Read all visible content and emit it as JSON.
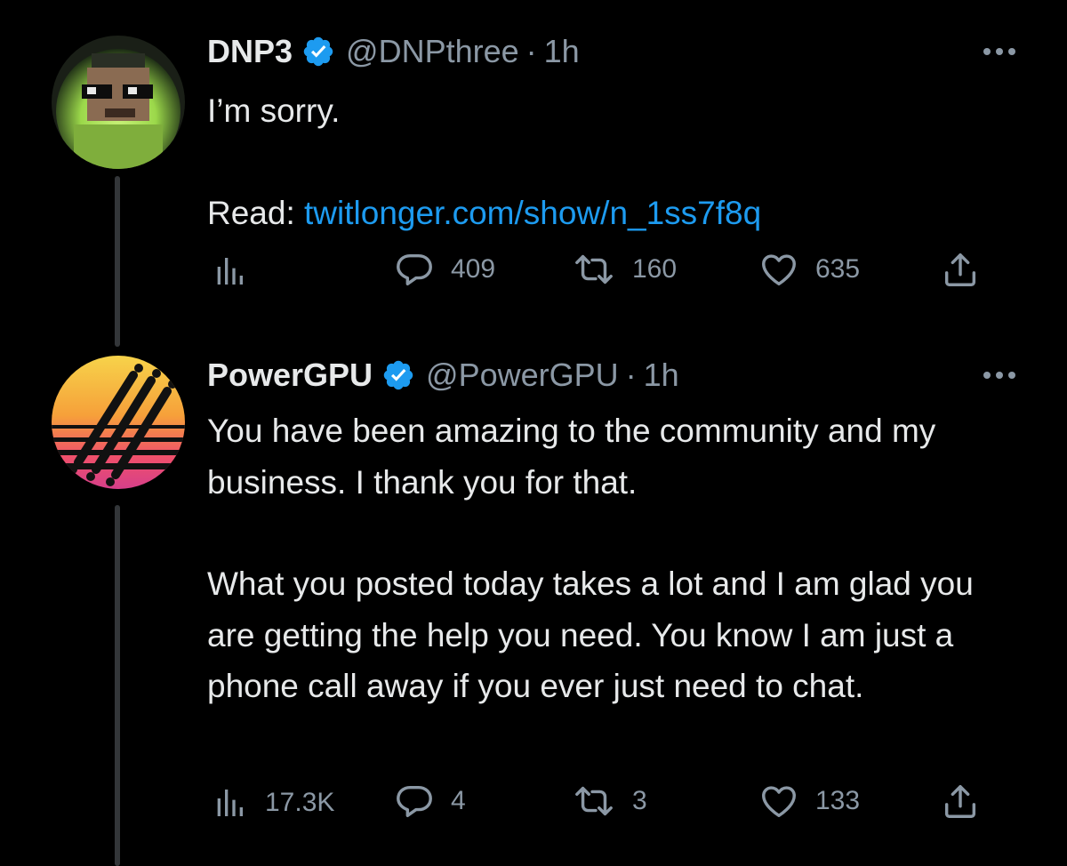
{
  "tweets": [
    {
      "name": "DNP3",
      "handle": "@DNPthree",
      "separator": "·",
      "time": "1h",
      "body": [
        "I’m sorry.",
        ""
      ],
      "read_prefix": "Read: ",
      "link": "twitlonger.com/show/n_1ss7f8q",
      "views": "",
      "replies": "409",
      "retweets": "160",
      "likes": "635"
    },
    {
      "name": "PowerGPU",
      "handle": "@PowerGPU",
      "separator": "·",
      "time": "1h",
      "body": [
        "You have been amazing to the community and my business. I thank you for that.",
        "What you posted today takes a lot and I am glad you are getting the help you need. You know I am just a phone call away if you ever just need to chat."
      ],
      "views": "17.3K",
      "replies": "4",
      "retweets": "3",
      "likes": "133"
    }
  ],
  "colors": {
    "background": "#000000",
    "text": "#e7e9ea",
    "muted": "#8b98a5",
    "link": "#1d9bf0",
    "verified": "#1d9bf0"
  },
  "icons": [
    "verified-badge-icon",
    "more-icon",
    "views-icon",
    "reply-icon",
    "retweet-icon",
    "like-icon",
    "share-icon"
  ]
}
